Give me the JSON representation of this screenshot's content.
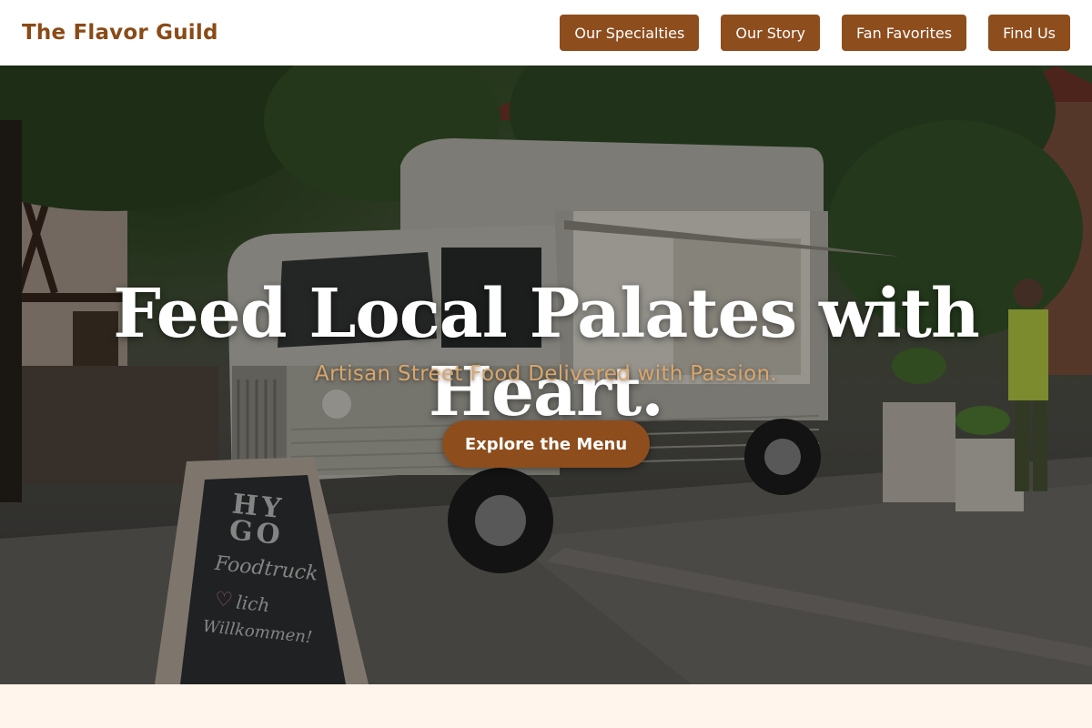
{
  "header": {
    "brand": "The Flavor Guild",
    "nav": [
      {
        "label": "Our Specialties"
      },
      {
        "label": "Our Story"
      },
      {
        "label": "Fan Favorites"
      },
      {
        "label": "Find Us"
      }
    ]
  },
  "hero": {
    "title": "Feed Local Palates with Heart.",
    "subtitle": "Artisan Street Food Delivered with Passion.",
    "cta_label": "Explore the Menu",
    "chalkboard": {
      "line1": "HY",
      "line2": "GO",
      "line3": "Foodtruck",
      "line4": "lich",
      "line5": "Willkommen!"
    }
  },
  "colors": {
    "brand": "#8a4a17",
    "button": "#8e4d1d",
    "subtitle": "#d9a66b",
    "footer_bg": "#fff5ec"
  }
}
